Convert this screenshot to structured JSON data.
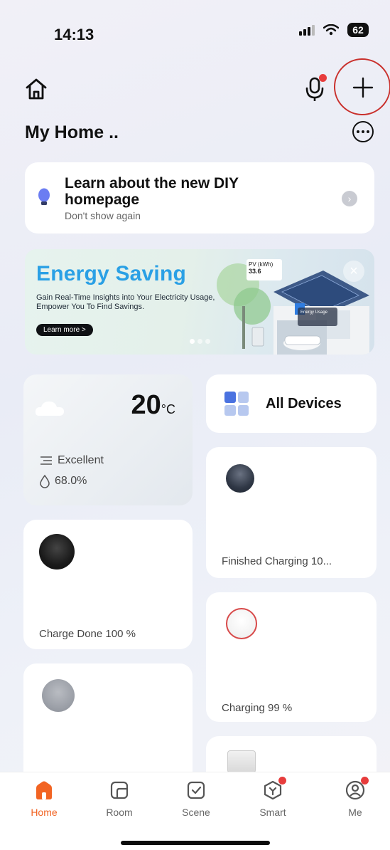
{
  "status_bar": {
    "time": "14:13",
    "battery": "62"
  },
  "header": {
    "title": "My Home .."
  },
  "tip": {
    "title": "Learn about the new DIY homepage",
    "subtitle": "Don't show again"
  },
  "banner": {
    "title": "Energy Saving",
    "description": "Gain Real-Time Insights into Your Electricity Usage, Empower You To Find Savings.",
    "button": "Learn more >",
    "pv_label": "PV",
    "pv_unit": "(kWh)",
    "pv_value": "33.6",
    "energy_usage_label": "Energy Usage",
    "close": "×"
  },
  "weather": {
    "temperature": "20",
    "unit": "°C",
    "air_quality": "Excellent",
    "humidity": "68.0%"
  },
  "all_devices": {
    "label": "All Devices"
  },
  "devices": [
    {
      "status": "Charge Done  100 %"
    },
    {
      "status": "Finished Charging  10..."
    },
    {
      "status": "Charging  99 %"
    },
    {
      "status": ""
    },
    {
      "status": ""
    }
  ],
  "nav": [
    {
      "label": "Home",
      "icon": "home-icon",
      "active": true
    },
    {
      "label": "Room",
      "icon": "room-icon"
    },
    {
      "label": "Scene",
      "icon": "scene-icon"
    },
    {
      "label": "Smart",
      "icon": "smart-icon"
    },
    {
      "label": "Me",
      "icon": "me-icon"
    }
  ],
  "colors": {
    "accent": "#f26423",
    "banner_title": "#2aa0e5",
    "alert_dot": "#e73c3c"
  }
}
